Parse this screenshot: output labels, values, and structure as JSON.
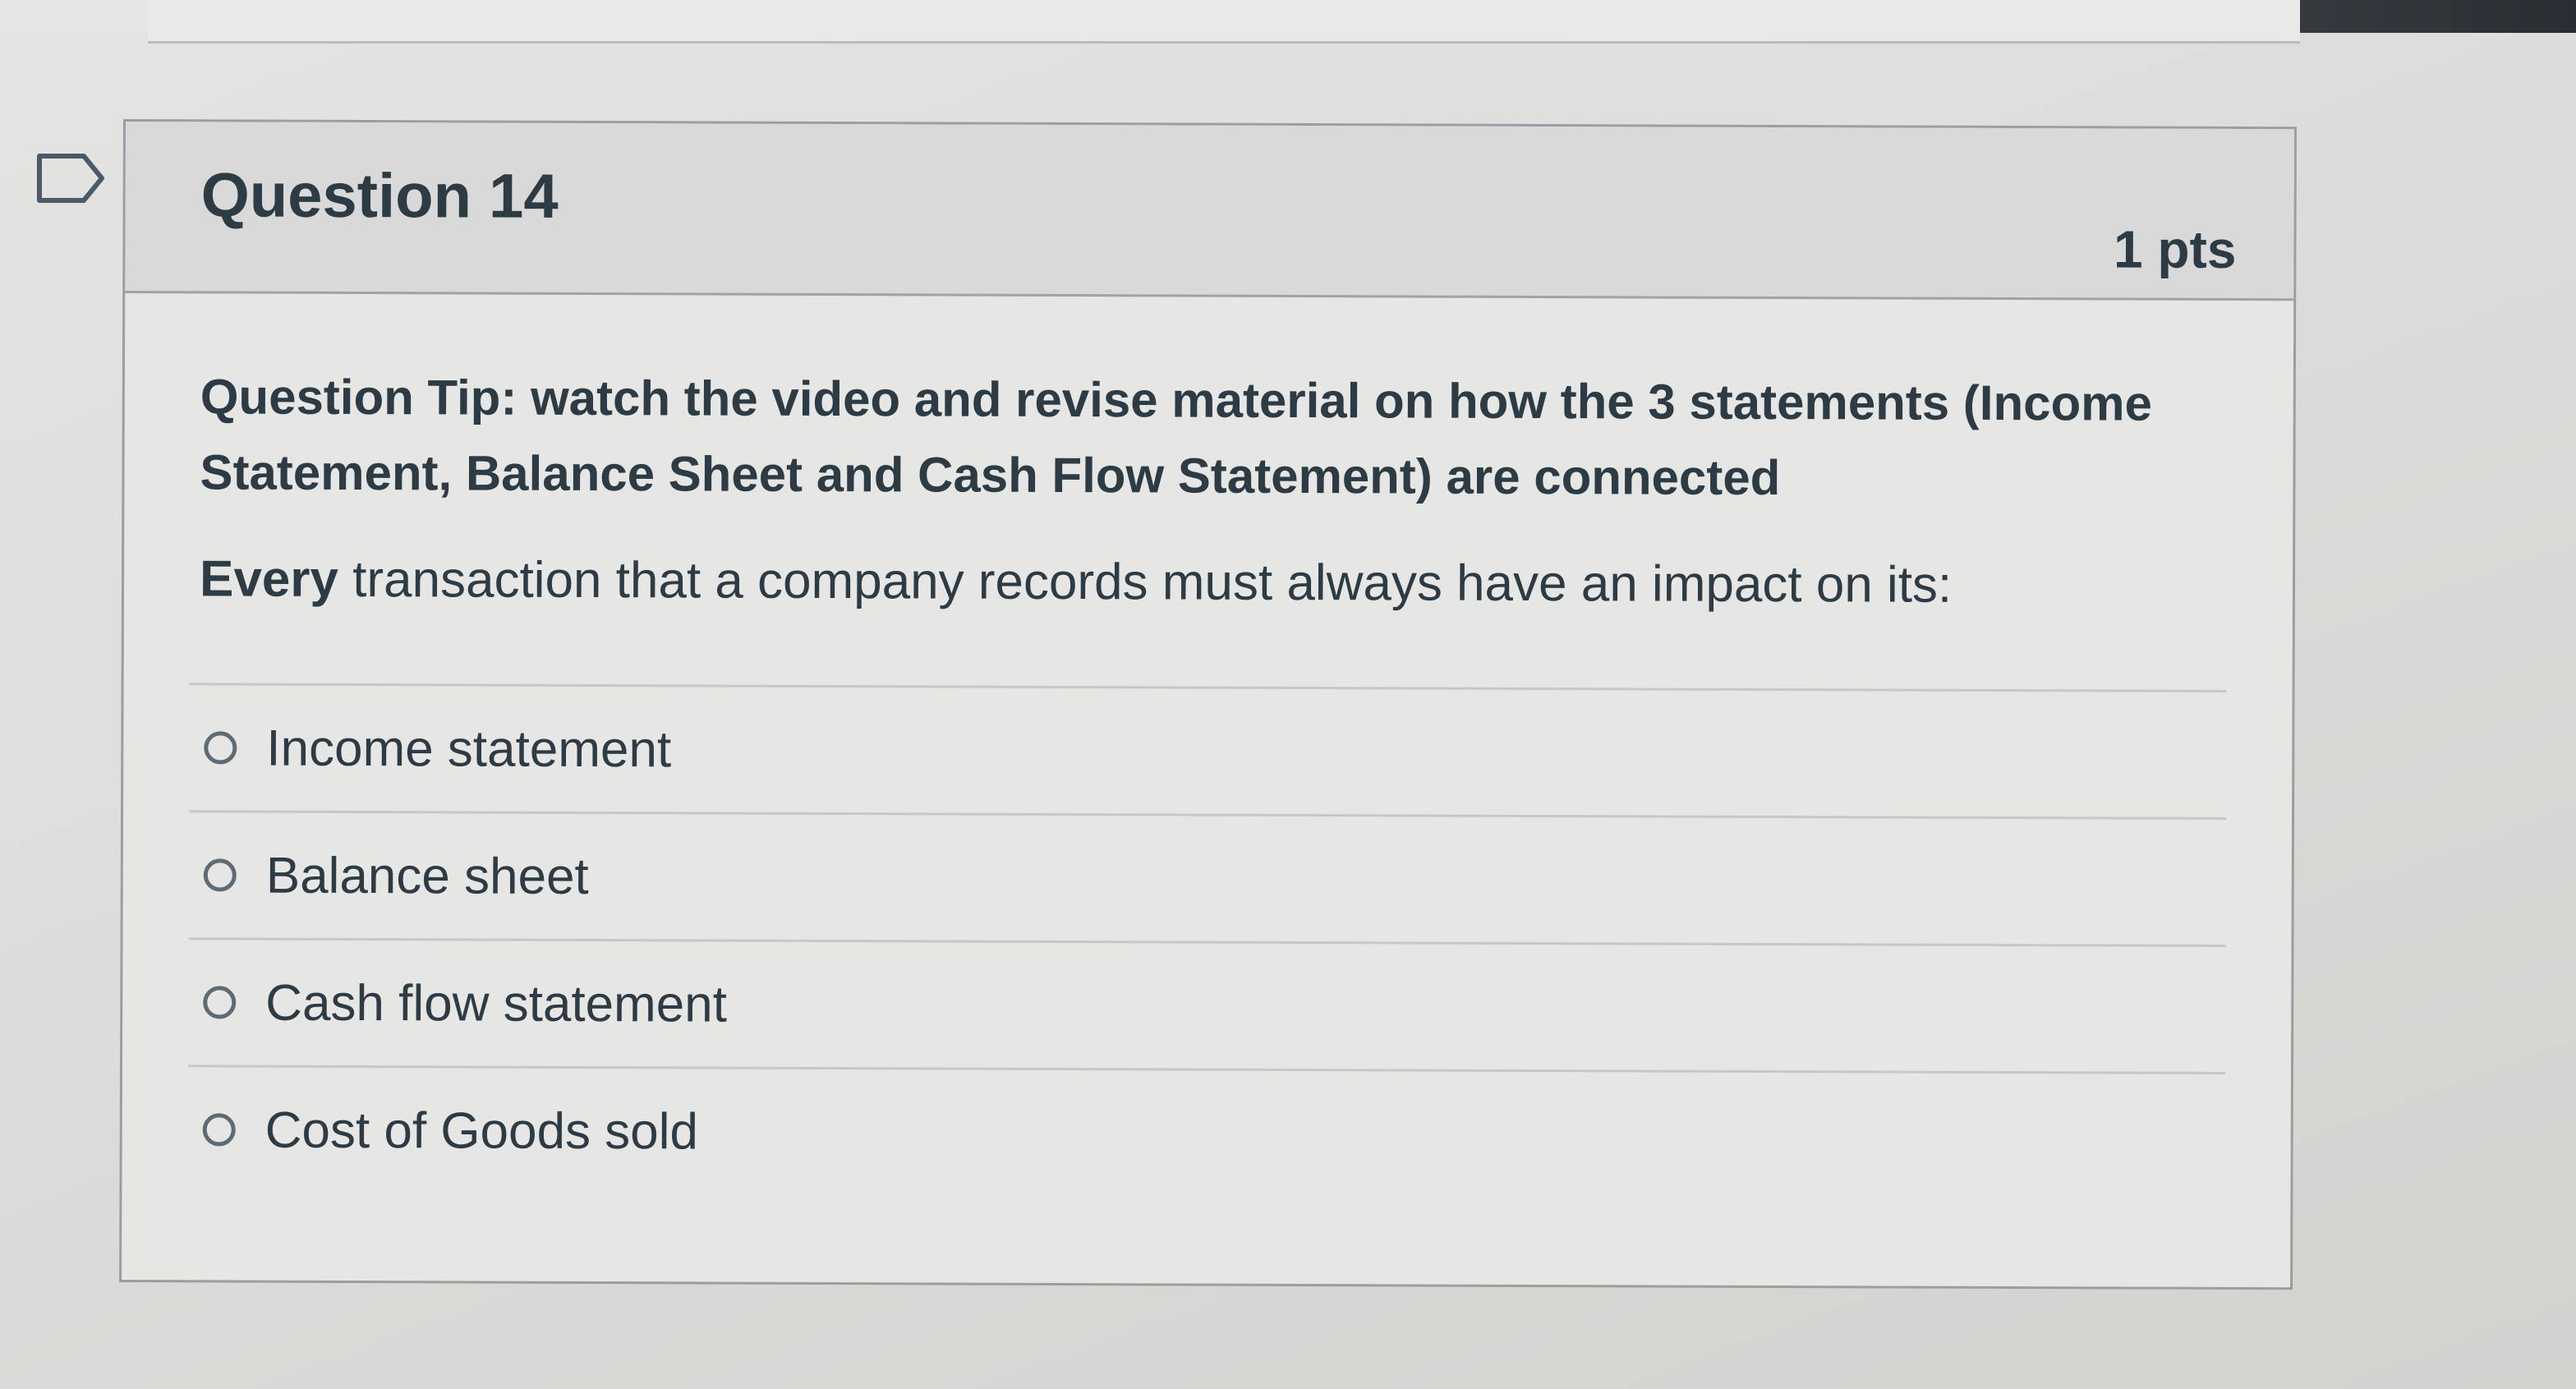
{
  "question": {
    "title": "Question 14",
    "points": "1 pts",
    "tip": "Question Tip: watch the video and revise material on how the 3 statements (Income Statement, Balance Sheet and Cash Flow Statement) are connected",
    "prompt_bold": "Every",
    "prompt_rest": " transaction that a company records must always have an impact on its:",
    "answers": [
      {
        "label": "Income statement"
      },
      {
        "label": "Balance sheet"
      },
      {
        "label": "Cash flow statement"
      },
      {
        "label": "Cost of Goods sold"
      }
    ]
  },
  "icons": {
    "flag": "flag-question-icon",
    "radio": "radio-unselected-icon"
  },
  "colors": {
    "text": "#2d3b45",
    "header_bg": "#d8d9d8",
    "border": "#9a9ea2"
  }
}
